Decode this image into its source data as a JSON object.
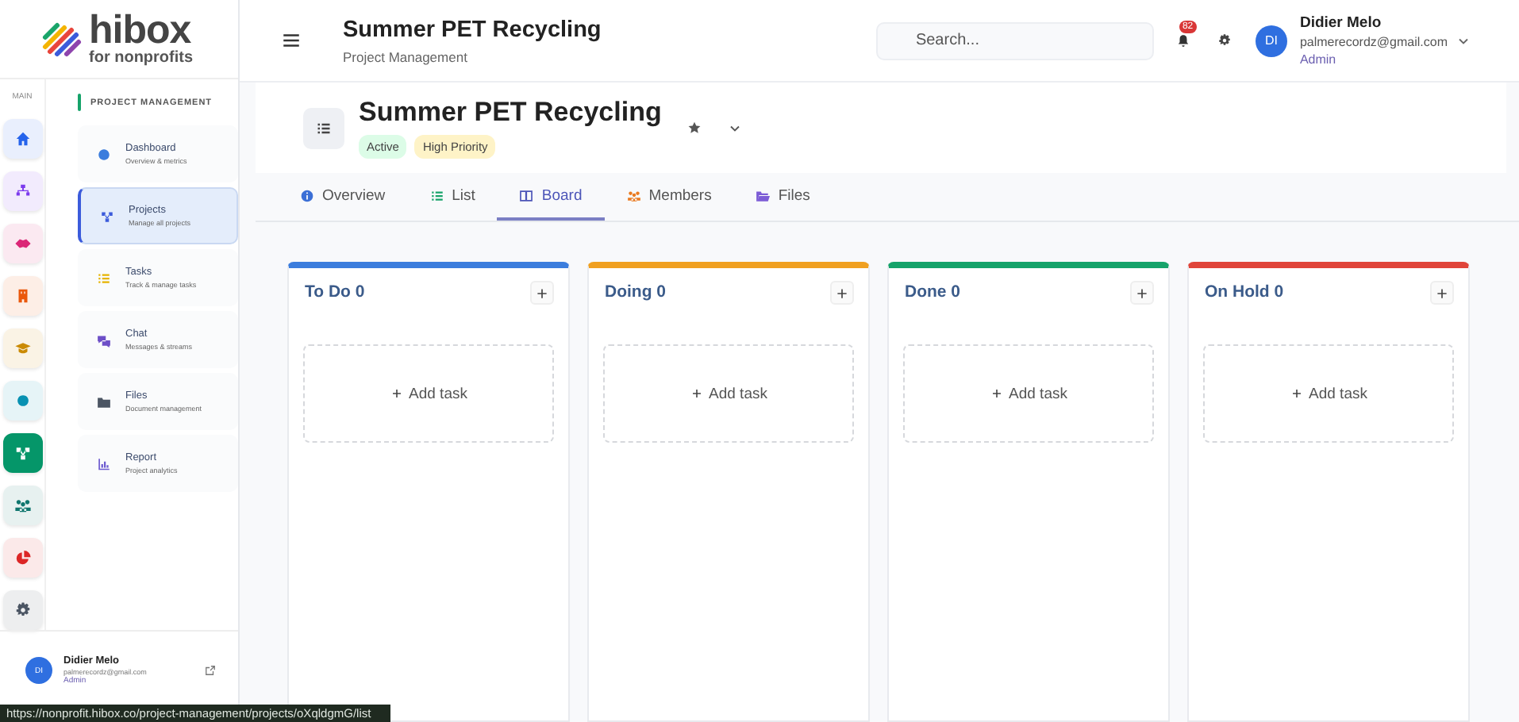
{
  "logo": {
    "name": "hibox",
    "tagline": "for nonprofits"
  },
  "rail": {
    "label": "MAIN",
    "items": [
      {
        "color": "#2563eb",
        "selected": false
      },
      {
        "color": "#7c3aed",
        "selected": false
      },
      {
        "color": "#db2777",
        "selected": false
      },
      {
        "color": "#ea580c",
        "selected": false
      },
      {
        "color": "#ca8a04",
        "selected": false
      },
      {
        "color": "#0891b2",
        "selected": false
      },
      {
        "color": "#059669",
        "selected": true
      },
      {
        "color": "#0f766e",
        "selected": false
      },
      {
        "color": "#dc2626",
        "selected": false
      },
      {
        "color": "#4b5563",
        "selected": false
      }
    ]
  },
  "sidebar": {
    "section": "PROJECT MANAGEMENT",
    "items": [
      {
        "label": "Dashboard",
        "sub": "Overview & metrics",
        "selected": false
      },
      {
        "label": "Projects",
        "sub": "Manage all projects",
        "selected": true
      },
      {
        "label": "Tasks",
        "sub": "Track & manage tasks",
        "selected": false
      },
      {
        "label": "Chat",
        "sub": "Messages & streams",
        "selected": false
      },
      {
        "label": "Files",
        "sub": "Document management",
        "selected": false
      },
      {
        "label": "Report",
        "sub": "Project analytics",
        "selected": false
      }
    ],
    "user": {
      "initials": "DI",
      "name": "Didier Melo",
      "email": "palmerecordz@gmail.com",
      "role": "Admin"
    }
  },
  "header": {
    "title": "Summer PET Recycling",
    "subtitle": "Project Management",
    "search": {
      "placeholder": "Search..."
    },
    "notification_count": "82",
    "user": {
      "initials": "DI",
      "name": "Didier Melo",
      "email": "palmerecordz@gmail.com",
      "role": "Admin"
    }
  },
  "project": {
    "title": "Summer PET Recycling",
    "tags": [
      {
        "label": "Active",
        "color": "#dcfce7"
      },
      {
        "label": "High Priority",
        "color": "#fef3c7"
      }
    ],
    "tabs": [
      {
        "label": "Overview",
        "selected": false
      },
      {
        "label": "List",
        "selected": false
      },
      {
        "label": "Board",
        "selected": true
      },
      {
        "label": "Members",
        "selected": false
      },
      {
        "label": "Files",
        "selected": false
      }
    ],
    "columns": [
      {
        "title": "To Do 0",
        "color": "#3b7ddd",
        "add_label": "Add task"
      },
      {
        "title": "Doing 0",
        "color": "#f0a020",
        "add_label": "Add task"
      },
      {
        "title": "Done 0",
        "color": "#16a36a",
        "add_label": "Add task"
      },
      {
        "title": "On Hold 0",
        "color": "#e0453a",
        "add_label": "Add task"
      }
    ]
  },
  "status_bar": {
    "url": "https://nonprofit.hibox.co/project-management/projects/oXqldgmG/list"
  }
}
